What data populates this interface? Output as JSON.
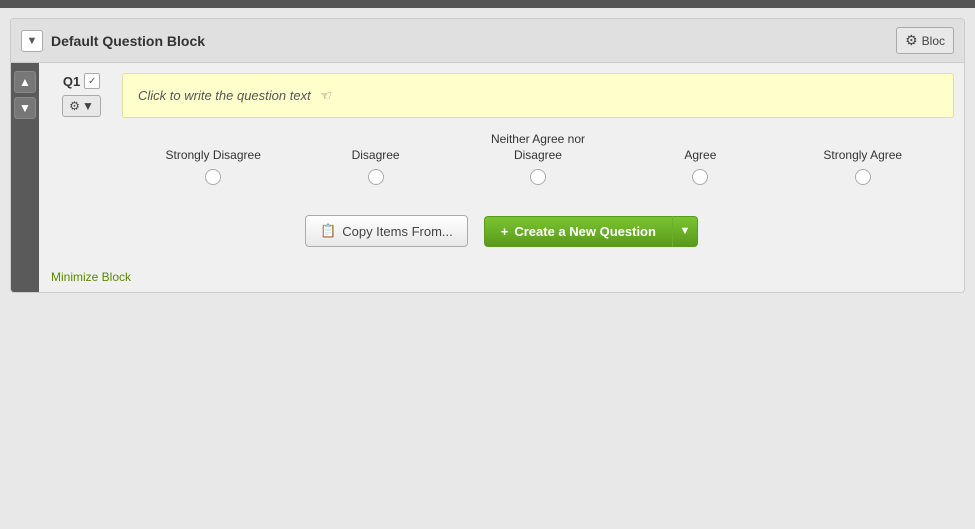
{
  "topbar": {
    "color": "#555555"
  },
  "block": {
    "collapse_btn_label": "▼",
    "title": "Default Question Block",
    "settings_btn_label": "Bloc",
    "settings_icon": "⚙"
  },
  "question": {
    "label": "Q1",
    "check_icon": "✓",
    "gear_icon": "⚙",
    "dropdown_arrow": "▼",
    "text_placeholder": "Click to write the question text",
    "cursor_icon": "☞"
  },
  "scale": {
    "options": [
      {
        "label": "Strongly Disagree"
      },
      {
        "label": "Disagree"
      },
      {
        "label": "Neither Agree nor Disagree"
      },
      {
        "label": "Agree"
      },
      {
        "label": "Strongly Agree"
      }
    ]
  },
  "actions": {
    "copy_items_icon": "📋",
    "copy_items_label": "Copy Items From...",
    "create_plus": "+",
    "create_label": "Create a New Question",
    "create_dropdown_arrow": "▼",
    "minimize_label": "Minimize Block"
  },
  "nav": {
    "up_arrow": "▲",
    "down_arrow": "▼"
  }
}
